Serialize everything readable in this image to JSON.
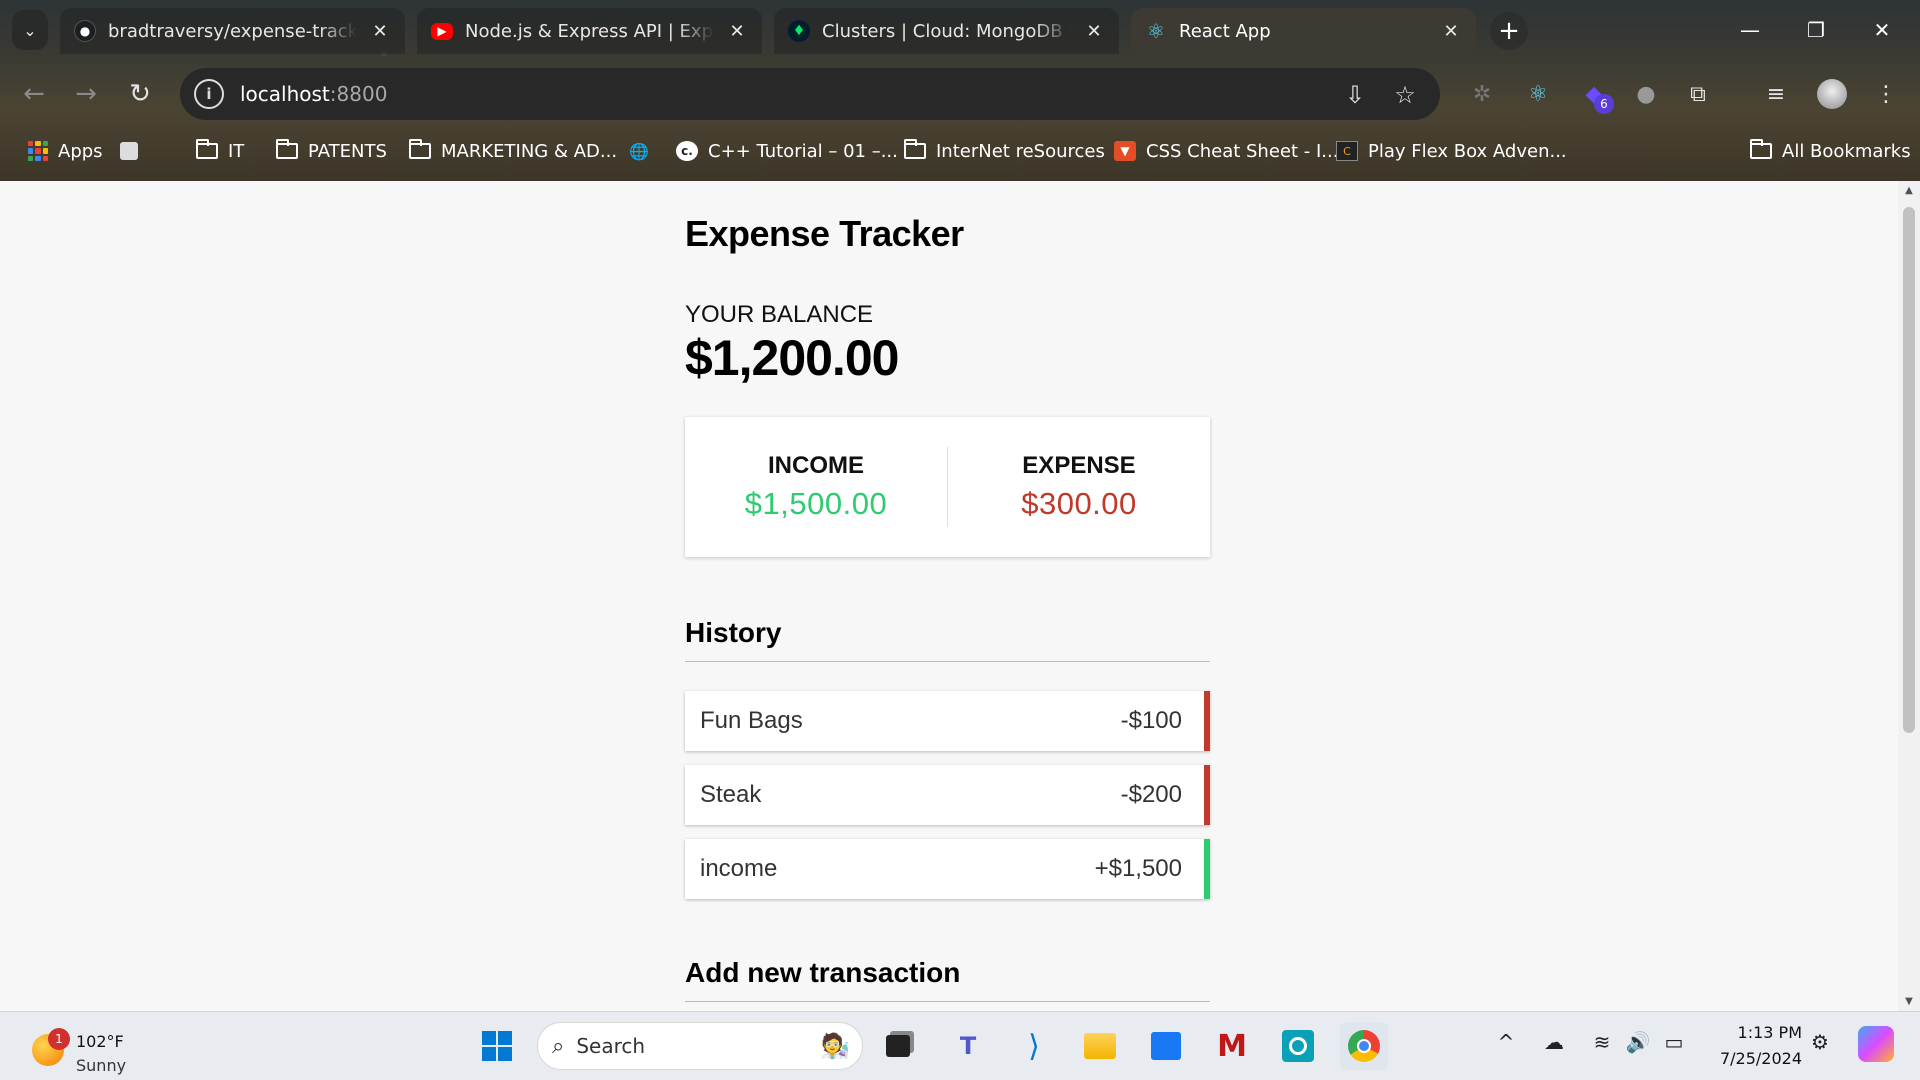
{
  "browser": {
    "tabs": [
      {
        "title": "bradtraversy/expense-tracker-mern",
        "icon": "github-icon",
        "active": false
      },
      {
        "title": "Node.js & Express API | Expense Tracker",
        "icon": "youtube-icon",
        "active": false
      },
      {
        "title": "Clusters | Cloud: MongoDB Cloud",
        "icon": "mongodb-leaf-icon",
        "active": false
      },
      {
        "title": "React App",
        "icon": "react-icon",
        "active": true
      }
    ],
    "url_host": "localhost",
    "url_port": ":8800",
    "extension_badge": "6",
    "bookmarks": [
      {
        "label": "Apps",
        "icon": "apps-grid-icon"
      },
      {
        "label": "IT",
        "icon": "folder-icon"
      },
      {
        "label": "PATENTS",
        "icon": "folder-icon"
      },
      {
        "label": "MARKETING & AD...",
        "icon": "folder-icon"
      },
      {
        "label": "C++ Tutorial – 01 –...",
        "icon": "cpp-icon"
      },
      {
        "label": "InterNet reSources",
        "icon": "folder-icon"
      },
      {
        "label": "CSS Cheat Sheet - I...",
        "icon": "css-icon"
      },
      {
        "label": "Play Flex Box Adven...",
        "icon": "game-icon"
      },
      {
        "label": "All Bookmarks",
        "icon": "folder-icon"
      }
    ]
  },
  "app": {
    "title": "Expense Tracker",
    "balance_label": "YOUR BALANCE",
    "balance": "$1,200.00",
    "income_label": "INCOME",
    "income": "$1,500.00",
    "expense_label": "EXPENSE",
    "expense": "$300.00",
    "history_title": "History",
    "transactions": [
      {
        "text": "Fun Bags",
        "amount": "-$100",
        "type": "minus"
      },
      {
        "text": "Steak",
        "amount": "-$200",
        "type": "minus"
      },
      {
        "text": "income",
        "amount": "+$1,500",
        "type": "plus"
      }
    ],
    "add_title": "Add new transaction"
  },
  "taskbar": {
    "weather_temp": "102°F",
    "weather_cond": "Sunny",
    "weather_badge": "1",
    "search_placeholder": "Search",
    "time": "1:13 PM",
    "date": "7/25/2024"
  },
  "colors": {
    "income": "#2ecc71",
    "expense": "#c0392b"
  }
}
